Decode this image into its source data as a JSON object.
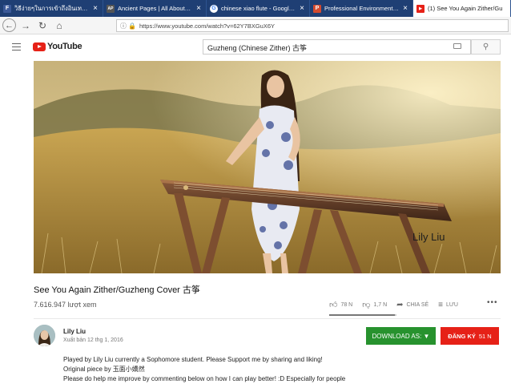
{
  "browser": {
    "tabs": [
      {
        "label": "วิธีง่ายๆในการเข้าถึงอินเทอร์เน็ต",
        "icon": "F",
        "icon_color": "#3b5998",
        "active": false
      },
      {
        "label": "Ancient Pages | All About The",
        "icon": "AP",
        "icon_color": "#555555",
        "active": false
      },
      {
        "label": "chinese xiao flute - Google Se",
        "icon": "G",
        "icon_color": "#4285f4",
        "active": false
      },
      {
        "label": "Professional Environmental Pu",
        "icon": "P",
        "icon_color": "#d44a2e",
        "active": false
      },
      {
        "label": "(1) See You Again Zither/Gu",
        "icon": "▶",
        "icon_color": "#e62117",
        "active": true
      }
    ],
    "close_glyph": "×",
    "url": "https://www.youtube.com/watch?v=62Y7BXGuX6Y"
  },
  "youtube": {
    "logo_text": "YouTube",
    "search_query": "Guzheng (Chinese Zither) 古筝",
    "video": {
      "watermark": "Lily Liu",
      "title": "See You Again Zither/Guzheng Cover 古筝",
      "views": "7.616.947 lượt xem",
      "like_count": "78 N",
      "dislike_count": "1,7 N",
      "share_label": "CHIA SẺ",
      "save_label": "LƯU",
      "like_ratio": 0.978
    },
    "channel": {
      "name": "Lily Liu",
      "published": "Xuất bản 12 thg 1, 2016"
    },
    "download_label": "DOWNLOAD AS: ▼",
    "subscribe_label": "ĐĂNG KÝ",
    "subscribe_count": "51 N",
    "description": [
      "Played by Lily Liu currently a Sophomore student. Please Support me by sharing and liking!",
      "Original piece by 玉面小嬌然",
      "Please do help me improve by commenting below on how I can play better! :D Especially for people"
    ],
    "colors": {
      "brand_red": "#e62117",
      "download_green": "#27922e",
      "tab_strip": "#1f3f74"
    }
  }
}
